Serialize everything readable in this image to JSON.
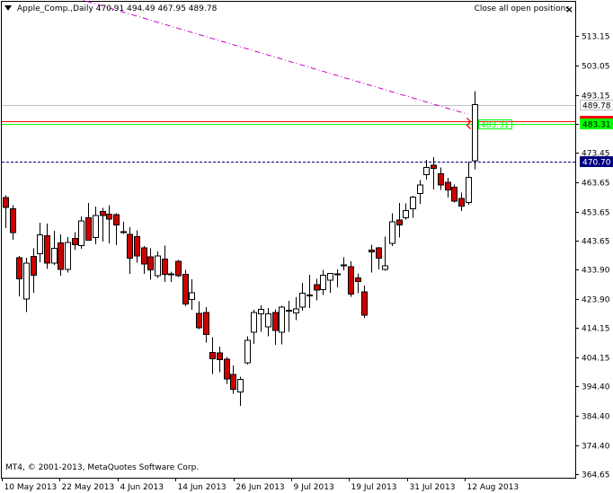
{
  "header": {
    "symbol_info": "Apple_Comp.,Daily  470.91 494.49 467.95 489.78",
    "close_all_label": "Close all open positions",
    "close_icon": "×"
  },
  "footer": {
    "copyright": "MT4, © 2001-2013, MetaQuotes Software Corp."
  },
  "colors": {
    "bull_candle": "#ffffff",
    "bear_candle": "#cc0000",
    "bid_line": "#c0c0c0",
    "stop_loss": "#ff0000",
    "take_profit": "#00ff00",
    "order_line": "#000080",
    "trend_line": "#cc00cc"
  },
  "chart_data": {
    "type": "candlestick",
    "y_ticks": [
      "513.15",
      "503.05",
      "493.15",
      "483.35",
      "473.45",
      "463.65",
      "453.65",
      "443.65",
      "433.90",
      "423.90",
      "414.15",
      "404.15",
      "394.40",
      "384.40",
      "374.40",
      "364.65"
    ],
    "x_labels": [
      "10 May 2013",
      "22 May 2013",
      "4 Jun 2013",
      "14 Jun 2013",
      "26 Jun 2013",
      "9 Jul 2013",
      "19 Jul 2013",
      "31 Jul 2013",
      "12 Aug 2013"
    ],
    "ylim": [
      364.65,
      513.15
    ],
    "price_labels": [
      {
        "text": "489.78",
        "value": 489.78,
        "style": "bid"
      },
      {
        "text": "484.31",
        "value": 484.31,
        "style": "sl"
      },
      {
        "text": "483.31",
        "value": 483.31,
        "style": "tp"
      },
      {
        "text": "470.70",
        "value": 470.7,
        "style": "order"
      }
    ],
    "order_marker": {
      "text": "483.31",
      "value": 483.31
    },
    "trend_line": {
      "from": [
        -1.2,
        533.9
      ],
      "to": [
        67,
        486.6
      ]
    },
    "candles": [
      {
        "o": 458.4,
        "h": 459.2,
        "l": 448.1,
        "c": 455.0
      },
      {
        "o": 454.5,
        "h": 455.8,
        "l": 444.0,
        "c": 446.5
      },
      {
        "o": 438.0,
        "h": 438.6,
        "l": 424.9,
        "c": 430.8
      },
      {
        "o": 424.0,
        "h": 438.0,
        "l": 419.6,
        "c": 436.2
      },
      {
        "o": 438.5,
        "h": 441.2,
        "l": 426.1,
        "c": 432.0
      },
      {
        "o": 439.3,
        "h": 449.8,
        "l": 436.5,
        "c": 445.7
      },
      {
        "o": 445.4,
        "h": 449.6,
        "l": 434.2,
        "c": 436.2
      },
      {
        "o": 436.2,
        "h": 447.1,
        "l": 435.5,
        "c": 441.2
      },
      {
        "o": 443.0,
        "h": 445.9,
        "l": 431.9,
        "c": 434.0
      },
      {
        "o": 434.0,
        "h": 445.0,
        "l": 433.0,
        "c": 443.2
      },
      {
        "o": 444.5,
        "h": 446.6,
        "l": 440.5,
        "c": 442.4
      },
      {
        "o": 442.1,
        "h": 452.0,
        "l": 441.1,
        "c": 450.5
      },
      {
        "o": 451.5,
        "h": 456.5,
        "l": 447.5,
        "c": 443.9
      },
      {
        "o": 444.9,
        "h": 455.3,
        "l": 442.5,
        "c": 452.3
      },
      {
        "o": 453.7,
        "h": 454.9,
        "l": 443.4,
        "c": 452.3
      },
      {
        "o": 452.8,
        "h": 455.8,
        "l": 442.8,
        "c": 451.0
      },
      {
        "o": 452.6,
        "h": 453.1,
        "l": 442.3,
        "c": 449.1
      },
      {
        "o": 446.8,
        "h": 450.1,
        "l": 446.1,
        "c": 446.8
      },
      {
        "o": 445.9,
        "h": 448.4,
        "l": 432.5,
        "c": 437.8
      },
      {
        "o": 445.2,
        "h": 447.3,
        "l": 436.3,
        "c": 438.6
      },
      {
        "o": 441.3,
        "h": 441.9,
        "l": 432.5,
        "c": 435.9
      },
      {
        "o": 438.3,
        "h": 441.2,
        "l": 430.6,
        "c": 433.9
      },
      {
        "o": 431.9,
        "h": 440.1,
        "l": 431.1,
        "c": 438.6
      },
      {
        "o": 437.6,
        "h": 442.1,
        "l": 429.8,
        "c": 432.4
      },
      {
        "o": 432.5,
        "h": 433.3,
        "l": 429.7,
        "c": 432.5
      },
      {
        "o": 436.8,
        "h": 437.3,
        "l": 431.5,
        "c": 431.9
      },
      {
        "o": 432.4,
        "h": 433.9,
        "l": 421.6,
        "c": 422.3
      },
      {
        "o": 423.9,
        "h": 430.7,
        "l": 420.3,
        "c": 426.1
      },
      {
        "o": 419.1,
        "h": 423.3,
        "l": 413.8,
        "c": 414.2
      },
      {
        "o": 419.4,
        "h": 421.3,
        "l": 409.2,
        "c": 412.0
      },
      {
        "o": 405.9,
        "h": 411.1,
        "l": 398.6,
        "c": 403.7
      },
      {
        "o": 405.7,
        "h": 407.8,
        "l": 399.2,
        "c": 403.5
      },
      {
        "o": 403.6,
        "h": 404.4,
        "l": 395.2,
        "c": 396.9
      },
      {
        "o": 398.5,
        "h": 401.4,
        "l": 391.9,
        "c": 393.4
      },
      {
        "o": 392.5,
        "h": 397.6,
        "l": 387.8,
        "c": 396.8
      },
      {
        "o": 402.4,
        "h": 411.3,
        "l": 401.7,
        "c": 410.0
      },
      {
        "o": 412.8,
        "h": 420.3,
        "l": 408.8,
        "c": 419.5
      },
      {
        "o": 418.9,
        "h": 421.8,
        "l": 412.9,
        "c": 420.5
      },
      {
        "o": 414.6,
        "h": 420.9,
        "l": 411.3,
        "c": 419.0
      },
      {
        "o": 419.4,
        "h": 420.5,
        "l": 408.4,
        "c": 413.4
      },
      {
        "o": 412.7,
        "h": 421.7,
        "l": 408.6,
        "c": 421.3
      },
      {
        "o": 419.9,
        "h": 423.4,
        "l": 412.9,
        "c": 420.2
      },
      {
        "o": 419.2,
        "h": 424.6,
        "l": 416.8,
        "c": 420.7
      },
      {
        "o": 421.3,
        "h": 429.4,
        "l": 420.0,
        "c": 425.9
      },
      {
        "o": 425.3,
        "h": 432.2,
        "l": 420.9,
        "c": 425.4
      },
      {
        "o": 428.9,
        "h": 430.9,
        "l": 423.6,
        "c": 427.0
      },
      {
        "o": 427.2,
        "h": 433.9,
        "l": 425.4,
        "c": 432.1
      },
      {
        "o": 430.4,
        "h": 432.8,
        "l": 426.1,
        "c": 432.7
      },
      {
        "o": 432.5,
        "h": 434.1,
        "l": 427.9,
        "c": 432.4
      },
      {
        "o": 435.5,
        "h": 438.1,
        "l": 433.8,
        "c": 435.2
      },
      {
        "o": 434.9,
        "h": 436.7,
        "l": 424.8,
        "c": 425.7
      },
      {
        "o": 431.2,
        "h": 432.7,
        "l": 425.9,
        "c": 429.9
      },
      {
        "o": 426.5,
        "h": 428.5,
        "l": 417.6,
        "c": 418.5
      },
      {
        "o": 440.6,
        "h": 442.4,
        "l": 433.0,
        "c": 440.0
      },
      {
        "o": 441.3,
        "h": 441.7,
        "l": 434.1,
        "c": 437.8
      },
      {
        "o": 434.1,
        "h": 445.1,
        "l": 433.5,
        "c": 435.2
      },
      {
        "o": 442.8,
        "h": 453.1,
        "l": 441.9,
        "c": 450.1
      },
      {
        "o": 450.8,
        "h": 456.5,
        "l": 444.8,
        "c": 449.1
      },
      {
        "o": 451.6,
        "h": 456.4,
        "l": 450.9,
        "c": 454.0
      },
      {
        "o": 454.5,
        "h": 459.0,
        "l": 451.6,
        "c": 458.6
      },
      {
        "o": 459.8,
        "h": 464.3,
        "l": 456.2,
        "c": 462.7
      },
      {
        "o": 466.2,
        "h": 471.2,
        "l": 464.5,
        "c": 468.5
      },
      {
        "o": 469.4,
        "h": 472.0,
        "l": 461.1,
        "c": 468.2
      },
      {
        "o": 466.4,
        "h": 468.6,
        "l": 461.0,
        "c": 462.7
      },
      {
        "o": 463.6,
        "h": 465.0,
        "l": 458.4,
        "c": 460.9
      },
      {
        "o": 461.9,
        "h": 462.8,
        "l": 456.7,
        "c": 457.2
      },
      {
        "o": 458.1,
        "h": 460.0,
        "l": 453.8,
        "c": 455.5
      },
      {
        "o": 456.7,
        "h": 470.5,
        "l": 456.0,
        "c": 465.3
      },
      {
        "o": 470.9,
        "h": 494.5,
        "l": 468.0,
        "c": 489.8
      }
    ]
  }
}
